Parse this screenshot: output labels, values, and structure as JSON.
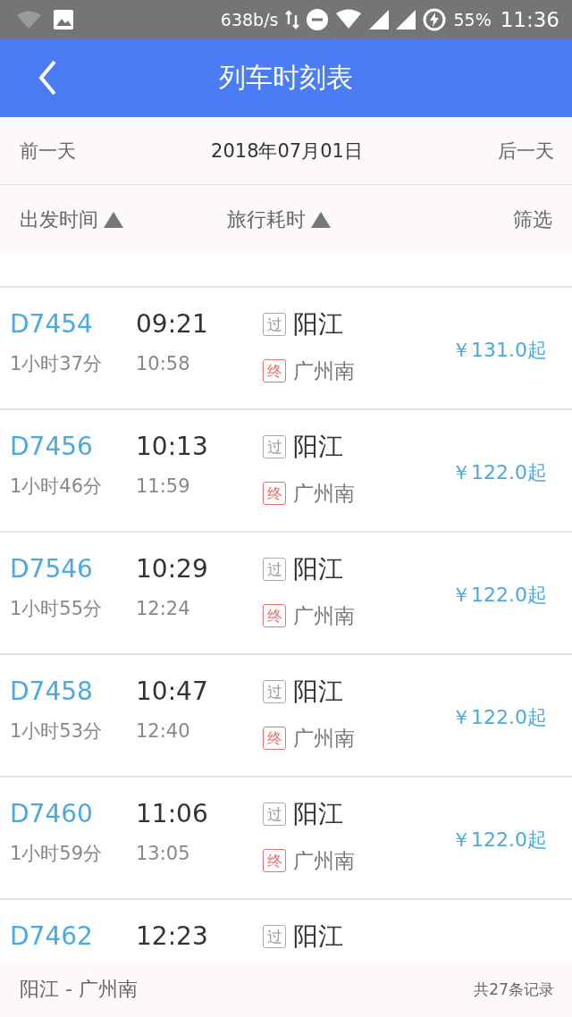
{
  "status_bar": {
    "speed": "638b/s",
    "battery": "55%",
    "time": "11:36"
  },
  "header": {
    "title": "列车时刻表"
  },
  "date_bar": {
    "prev": "前一天",
    "date": "2018年07月01日",
    "next": "后一天"
  },
  "sort_bar": {
    "sorts": [
      {
        "label": "出发时间"
      },
      {
        "label": "旅行耗时"
      }
    ],
    "filter": "筛选"
  },
  "trains": [
    {
      "number": "D7454",
      "depart": "09:21",
      "duration": "1小时37分",
      "arrive": "10:58",
      "stops": [
        {
          "kind": "pass",
          "badge": "过",
          "station": "阳江"
        },
        {
          "kind": "terminal",
          "badge": "终",
          "station": "广州南"
        }
      ],
      "price": "￥131.0起"
    },
    {
      "number": "D7456",
      "depart": "10:13",
      "duration": "1小时46分",
      "arrive": "11:59",
      "stops": [
        {
          "kind": "pass",
          "badge": "过",
          "station": "阳江"
        },
        {
          "kind": "terminal",
          "badge": "终",
          "station": "广州南"
        }
      ],
      "price": "￥122.0起"
    },
    {
      "number": "D7546",
      "depart": "10:29",
      "duration": "1小时55分",
      "arrive": "12:24",
      "stops": [
        {
          "kind": "pass",
          "badge": "过",
          "station": "阳江"
        },
        {
          "kind": "terminal",
          "badge": "终",
          "station": "广州南"
        }
      ],
      "price": "￥122.0起"
    },
    {
      "number": "D7458",
      "depart": "10:47",
      "duration": "1小时53分",
      "arrive": "12:40",
      "stops": [
        {
          "kind": "pass",
          "badge": "过",
          "station": "阳江"
        },
        {
          "kind": "terminal",
          "badge": "终",
          "station": "广州南"
        }
      ],
      "price": "￥122.0起"
    },
    {
      "number": "D7460",
      "depart": "11:06",
      "duration": "1小时59分",
      "arrive": "13:05",
      "stops": [
        {
          "kind": "pass",
          "badge": "过",
          "station": "阳江"
        },
        {
          "kind": "terminal",
          "badge": "终",
          "station": "广州南"
        }
      ],
      "price": "￥122.0起"
    },
    {
      "number": "D7462",
      "depart": "12:23",
      "stops": [
        {
          "kind": "pass",
          "badge": "过",
          "station": "阳江"
        }
      ]
    }
  ],
  "footer": {
    "route": "阳江 - 广州南",
    "count": "共27条记录"
  }
}
